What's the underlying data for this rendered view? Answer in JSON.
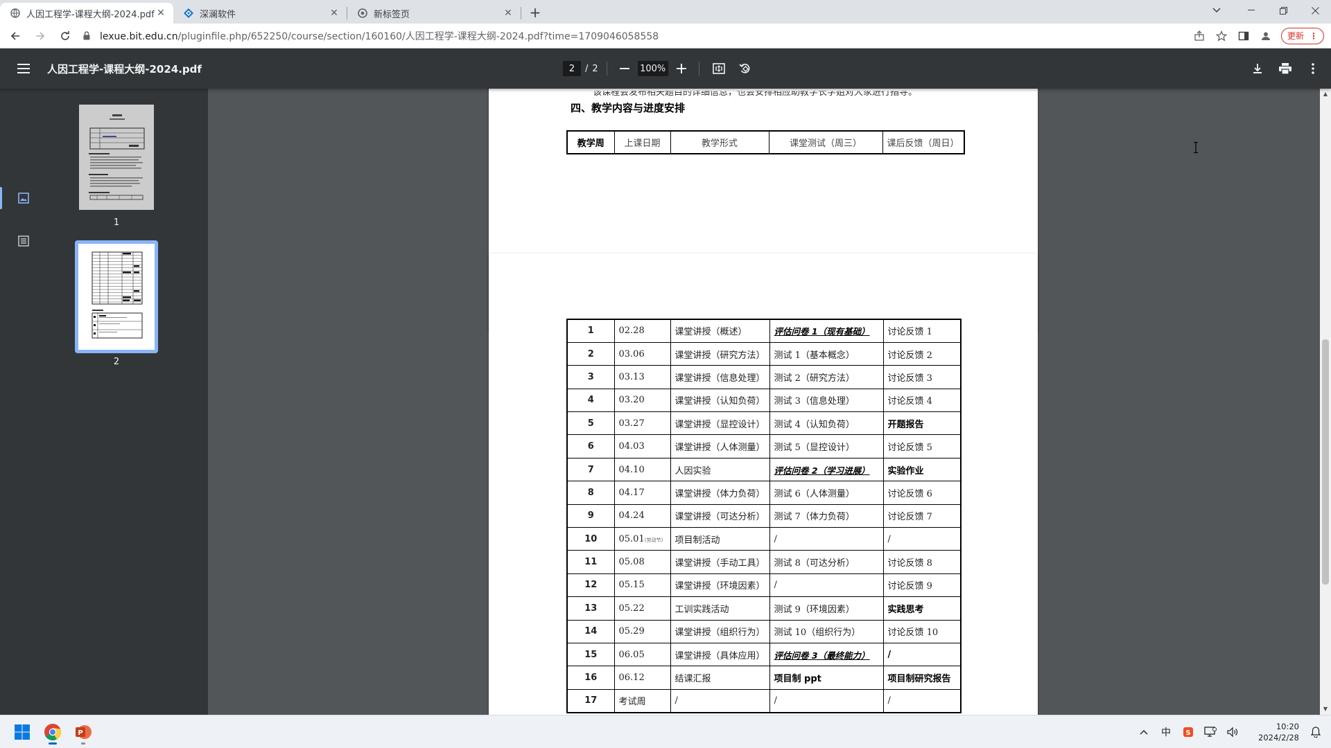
{
  "browser": {
    "tabs": [
      {
        "title": "人因工程学-课程大纲-2024.pdf",
        "active": true,
        "icon": "globe-icon"
      },
      {
        "title": "深澜软件",
        "active": false,
        "icon": "srun-logo-icon"
      },
      {
        "title": "新标签页",
        "active": false,
        "icon": "chrome-icon"
      }
    ],
    "new_tab_label": "+",
    "url_host": "lexue.bit.edu.cn",
    "url_path": "/pluginfile.php/652250/course/section/160160/人因工程学-课程大纲-2024.pdf?time=1709046058558",
    "update_label": "更新"
  },
  "pdf": {
    "title": "人因工程学-课程大纲-2024.pdf",
    "current_page": "2",
    "page_separator": "/",
    "total_pages": "2",
    "zoom": "100%",
    "thumbnails": [
      {
        "label": "1"
      },
      {
        "label": "2"
      }
    ]
  },
  "document": {
    "cut_line": "该课程会发布相关题目的详细信息，也会安排相应助教学长学姐对大家进行指导。",
    "section_heading": "四、教学内容与进度安排",
    "headers": {
      "week": "教学周",
      "date": "上课日期",
      "form": "教学形式",
      "test": "课堂测试（周三）",
      "feedback": "课后反馈（周日）"
    },
    "rows": [
      {
        "week": "1",
        "date": "02.28",
        "form": "课堂讲授（概述）",
        "test": "评估问卷 1（现有基础）",
        "feedback": "讨论反馈 1"
      },
      {
        "week": "2",
        "date": "03.06",
        "form": "课堂讲授（研究方法）",
        "test": "测试 1（基本概念）",
        "feedback": "讨论反馈 2"
      },
      {
        "week": "3",
        "date": "03.13",
        "form": "课堂讲授（信息处理）",
        "test": "测试 2（研究方法）",
        "feedback": "讨论反馈 3"
      },
      {
        "week": "4",
        "date": "03.20",
        "form": "课堂讲授（认知负荷）",
        "test": "测试 3（信息处理）",
        "feedback": "讨论反馈 4"
      },
      {
        "week": "5",
        "date": "03.27",
        "form": "课堂讲授（显控设计）",
        "test": "测试 4（认知负荷）",
        "feedback": "开题报告"
      },
      {
        "week": "6",
        "date": "04.03",
        "form": "课堂讲授（人体测量）",
        "test": "测试 5（显控设计）",
        "feedback": "讨论反馈 5"
      },
      {
        "week": "7",
        "date": "04.10",
        "form": "人因实验",
        "test": "评估问卷 2（学习进展）",
        "feedback": "实验作业"
      },
      {
        "week": "8",
        "date": "04.17",
        "form": "课堂讲授（体力负荷）",
        "test": "测试 6（人体测量）",
        "feedback": "讨论反馈 6"
      },
      {
        "week": "9",
        "date": "04.24",
        "form": "课堂讲授（可达分析）",
        "test": "测试 7（体力负荷）",
        "feedback": "讨论反馈 7"
      },
      {
        "week": "10",
        "date": "05.01",
        "date_note": "(劳动节)",
        "form": "项目制活动",
        "test": "/",
        "feedback": "/"
      },
      {
        "week": "11",
        "date": "05.08",
        "form": "课堂讲授（手动工具）",
        "test": "测试 8（可达分析）",
        "feedback": "讨论反馈 8"
      },
      {
        "week": "12",
        "date": "05.15",
        "form": "课堂讲授（环境因素）",
        "test": "/",
        "feedback": "讨论反馈 9"
      },
      {
        "week": "13",
        "date": "05.22",
        "form": "工训实践活动",
        "test": "测试 9（环境因素）",
        "feedback": "实践思考"
      },
      {
        "week": "14",
        "date": "05.29",
        "form": "课堂讲授（组织行为）",
        "test": "测试 10（组织行为）",
        "feedback": "讨论反馈 10"
      },
      {
        "week": "15",
        "date": "06.05",
        "form": "课堂讲授（具体应用）",
        "test": "评估问卷 3（最终能力）",
        "feedback": "/"
      },
      {
        "week": "16",
        "date": "06.12",
        "form": "结课汇报",
        "test": "项目制 ppt",
        "feedback": "项目制研究报告"
      },
      {
        "week": "17",
        "date": "考试周",
        "form": "/",
        "test": "/",
        "feedback": "/"
      }
    ],
    "emphasized_tests": [
      0,
      6,
      14
    ],
    "bold_tests": [
      15
    ],
    "bold_feedback": [
      4,
      6,
      12,
      14,
      15
    ]
  },
  "taskbar": {
    "apps": [
      "windows-start-icon",
      "chrome-icon",
      "powerpoint-icon"
    ],
    "ime": "中",
    "time": "10:20",
    "date": "2024/2/28"
  },
  "colors": {
    "pdf_toolbar": "#323639",
    "viewer_bg": "#525659",
    "accent": "#8ab4f8",
    "update_red": "#d93025"
  }
}
